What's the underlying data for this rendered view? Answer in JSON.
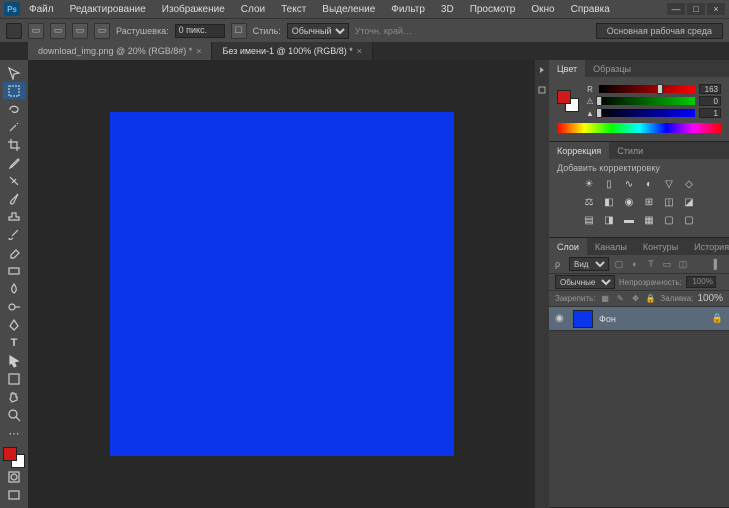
{
  "app": {
    "logo": "Ps"
  },
  "menu": [
    "Файл",
    "Редактирование",
    "Изображение",
    "Слои",
    "Текст",
    "Выделение",
    "Фильтр",
    "3D",
    "Просмотр",
    "Окно",
    "Справка"
  ],
  "window_controls": {
    "min": "—",
    "max": "□",
    "close": "×"
  },
  "options": {
    "feather_label": "Растушевка:",
    "feather_value": "0 пикс.",
    "style_label": "Стиль:",
    "style_value": "Обычный",
    "refine_label": "Уточн. край…",
    "workspace": "Основная рабочая среда"
  },
  "tabs": [
    {
      "label": "download_img.png @ 20% (RGB/8#) *",
      "active": false
    },
    {
      "label": "Без имени-1 @ 100% (RGB/8) *",
      "active": true
    }
  ],
  "colors": {
    "foreground": "#d01a1a",
    "background": "#ffffff",
    "canvas_fill": "#0b35ea"
  },
  "color_panel": {
    "tab_color": "Цвет",
    "tab_swatches": "Образцы",
    "r": 163,
    "g": 0,
    "b": 1
  },
  "adjustments": {
    "tab_adj": "Коррекция",
    "tab_styles": "Стили",
    "add_label": "Добавить корректировку"
  },
  "layers": {
    "tab_layers": "Слои",
    "tab_channels": "Каналы",
    "tab_paths": "Контуры",
    "tab_history": "История",
    "filter_kind": "Вид",
    "blend_mode": "Обычные",
    "opacity_label": "Непрозрачность:",
    "opacity_value": "100%",
    "lock_label": "Закрепить:",
    "fill_label": "Заливка:",
    "fill_value": "100%",
    "items": [
      {
        "name": "Фон",
        "locked": true
      }
    ]
  }
}
